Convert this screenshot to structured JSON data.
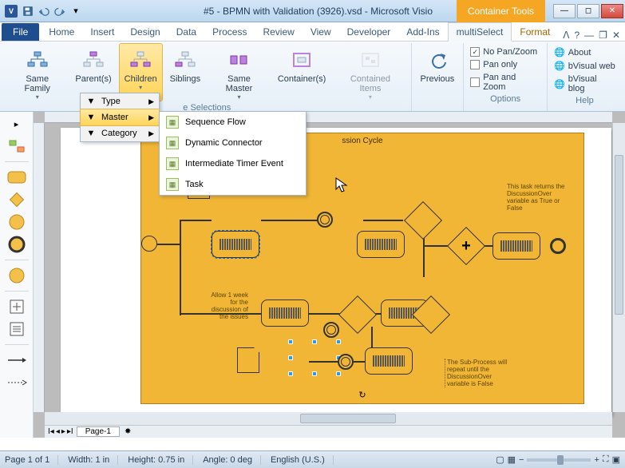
{
  "titlebar": {
    "title": "#5 - BPMN with Validation (3926).vsd - Microsoft Visio",
    "container_tools": "Container Tools",
    "app_initial": "V"
  },
  "tabs": {
    "file": "File",
    "list": [
      "Home",
      "Insert",
      "Design",
      "Data",
      "Process",
      "Review",
      "View",
      "Developer",
      "Add-Ins",
      "multiSelect"
    ],
    "contextual": "Format",
    "active": "multiSelect"
  },
  "ribbon": {
    "group_selections": "e Selections",
    "group_options": "Options",
    "group_help": "Help",
    "buttons": {
      "same_family": "Same\nFamily",
      "parents": "Parent(s)",
      "children": "Children",
      "siblings": "Siblings",
      "same_master": "Same\nMaster",
      "containers": "Container(s)",
      "contained_items": "Contained\nItems",
      "previous": "Previous"
    },
    "options": {
      "no_panzoom": "No Pan/Zoom",
      "pan_only": "Pan only",
      "pan_and_zoom": "Pan and Zoom",
      "no_panzoom_checked": true
    },
    "help": {
      "about": "About",
      "web": "bVisual web",
      "blog": "bVisual blog"
    }
  },
  "menu1": {
    "type": "Type",
    "master": "Master",
    "category": "Category"
  },
  "menu2": {
    "items": [
      "Sequence Flow",
      "Dynamic Connector",
      "Intermediate Timer Event",
      "Task"
    ]
  },
  "canvas": {
    "process_title": "ssion Cycle",
    "note1": "This task returns the DiscussionOver variable as True or False",
    "note2": "Allow 1 week for the discussion of the issues",
    "note3": "The Sub-Process will repeat until the DiscussionOver variable is False"
  },
  "pagetabs": {
    "page1": "Page-1"
  },
  "statusbar": {
    "page": "Page 1 of 1",
    "width": "Width: 1 in",
    "height": "Height: 0.75 in",
    "angle": "Angle: 0 deg",
    "lang": "English (U.S.)",
    "zoom_minus": "−",
    "zoom_plus": "+"
  }
}
